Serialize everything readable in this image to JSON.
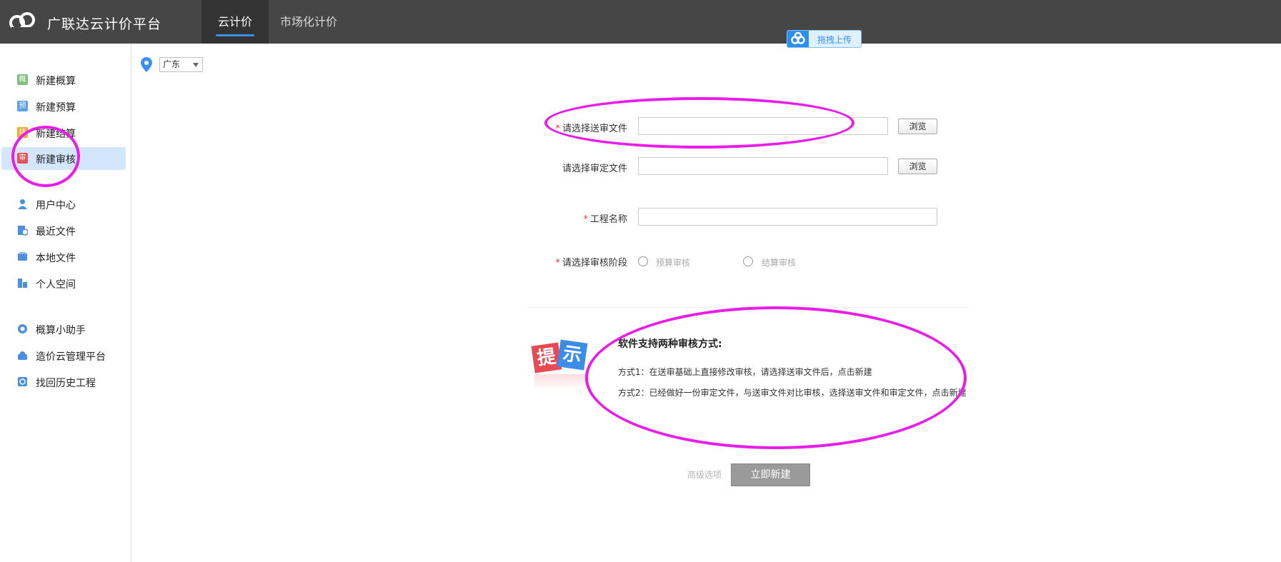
{
  "header": {
    "app_title": "广联达云计价平台",
    "tabs": [
      {
        "label": "云计价",
        "active": true
      },
      {
        "label": "市场化计价",
        "active": false
      }
    ],
    "drag_upload_label": "拖拽上传"
  },
  "sidebar": {
    "items": [
      {
        "label": "新建概算",
        "icon": "estimate-icon",
        "color": "#7ec27e",
        "glyph": "概"
      },
      {
        "label": "新建预算",
        "icon": "budget-icon",
        "color": "#5aa0e8",
        "glyph": "预"
      },
      {
        "label": "新建结算",
        "icon": "settlement-icon",
        "color": "#f0a830",
        "glyph": "结"
      },
      {
        "label": "新建审核",
        "icon": "audit-icon",
        "color": "#e8505a",
        "glyph": "审",
        "active": true
      },
      {
        "label": "用户中心",
        "icon": "user-icon",
        "color": "#4a90e2"
      },
      {
        "label": "最近文件",
        "icon": "recent-files-icon",
        "color": "#4a90e2"
      },
      {
        "label": "本地文件",
        "icon": "local-files-icon",
        "color": "#4a90e2"
      },
      {
        "label": "个人空间",
        "icon": "personal-space-icon",
        "color": "#4a90e2"
      },
      {
        "label": "概算小助手",
        "icon": "assistant-icon",
        "color": "#4a90e2"
      },
      {
        "label": "造价云管理平台",
        "icon": "cloud-platform-icon",
        "color": "#4a90e2"
      },
      {
        "label": "找回历史工程",
        "icon": "history-icon",
        "color": "#4a90e2"
      }
    ]
  },
  "location": {
    "selected": "广东"
  },
  "form": {
    "submit_file_label": "请选择送审文件",
    "submit_file_value": "",
    "approved_file_label": "请选择审定文件",
    "approved_file_value": "",
    "project_name_label": "工程名称",
    "project_name_value": "",
    "stage_label": "请选择审核阶段",
    "stage_options": [
      "预算审核",
      "结算审核"
    ],
    "browse_label": "浏览",
    "required_mark": "*"
  },
  "tip": {
    "badge_chars": [
      "提",
      "示"
    ],
    "title": "软件支持两种审核方式:",
    "line1": "方式1：在送审基础上直接修改审核，请选择送审文件后，点击新建",
    "line2": "方式2：已经做好一份审定文件，与送审文件对比审核，选择送审文件和审定文件，点击新建"
  },
  "actions": {
    "advanced_label": "高级选项",
    "create_label": "立即新建"
  },
  "colors": {
    "topbar": "#464646",
    "accent": "#3b8ff0",
    "annotation": "#e81ee8",
    "sidebar_active": "#d3e6fb"
  }
}
